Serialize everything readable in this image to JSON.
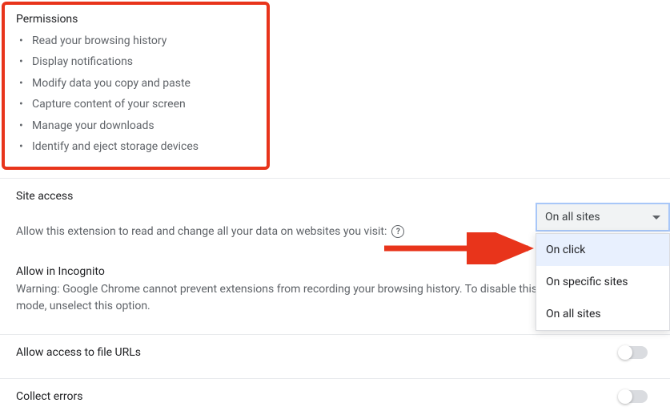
{
  "permissions": {
    "title": "Permissions",
    "items": [
      "Read your browsing history",
      "Display notifications",
      "Modify data you copy and paste",
      "Capture content of your screen",
      "Manage your downloads",
      "Identify and eject storage devices"
    ]
  },
  "site_access": {
    "title": "Site access",
    "label": "Allow this extension to read and change all your data on websites you visit:",
    "dropdown": {
      "selected": "On all sites",
      "options": [
        "On click",
        "On specific sites",
        "On all sites"
      ]
    }
  },
  "incognito": {
    "title": "Allow in Incognito",
    "warning": "Warning: Google Chrome cannot prevent extensions from recording your browsing history. To disable this extension in Incognito mode, unselect this option."
  },
  "file_urls": {
    "label": "Allow access to file URLs"
  },
  "collect_errors": {
    "label": "Collect errors"
  }
}
